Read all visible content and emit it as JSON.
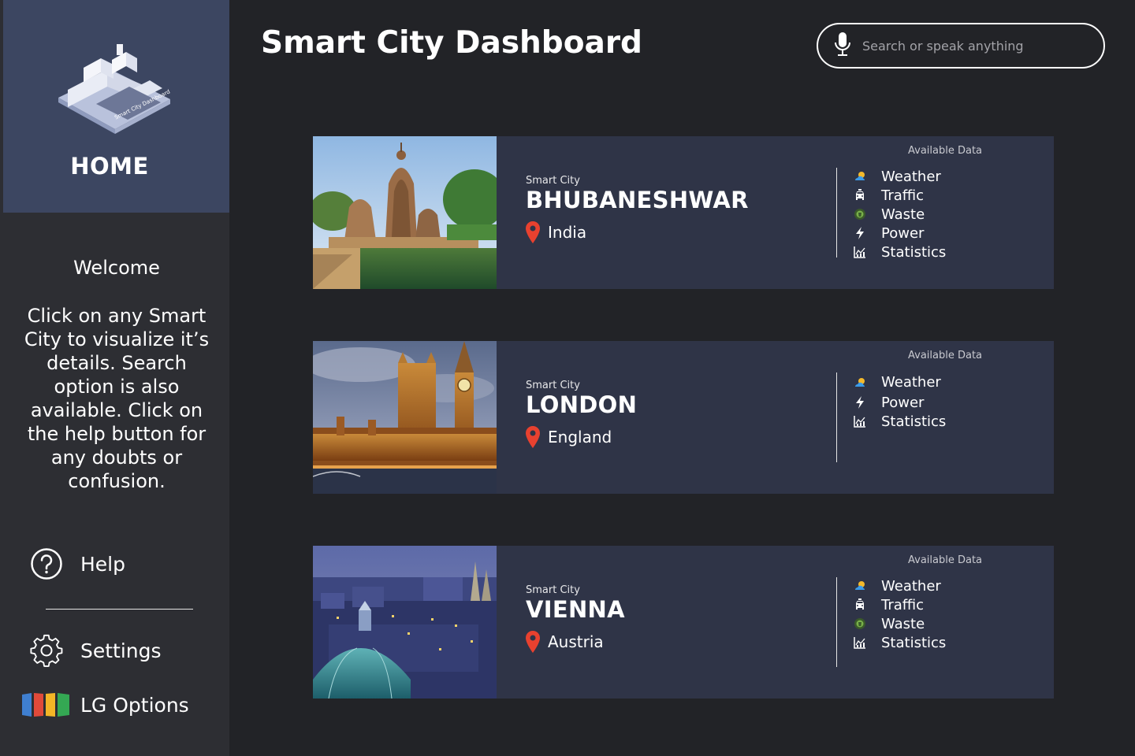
{
  "sidebar": {
    "home_label": "HOME",
    "welcome_title": "Welcome",
    "welcome_text": "Click on any Smart City to visualize it’s details. Search option is also available. Click on the help button for any doubts or confusion.",
    "help_label": "Help",
    "settings_label": "Settings",
    "lg_label": "LG Options"
  },
  "header": {
    "title": "Smart City Dashboard",
    "search_placeholder": "Search or speak anything"
  },
  "colors": {
    "background": "#222327",
    "sidebar": "#2d2e33",
    "home_panel": "#3c4661",
    "card": "#2f3447",
    "pin": "#e8412f"
  },
  "available_label": "Available Data",
  "city_kicker": "Smart City",
  "cities": [
    {
      "name": "BHUBANESHWAR",
      "country": "India",
      "data": [
        {
          "icon": "weather-icon",
          "label": "Weather"
        },
        {
          "icon": "traffic-icon",
          "label": "Traffic"
        },
        {
          "icon": "waste-icon",
          "label": "Waste"
        },
        {
          "icon": "power-icon",
          "label": "Power"
        },
        {
          "icon": "statistics-icon",
          "label": "Statistics"
        }
      ]
    },
    {
      "name": "LONDON",
      "country": "England",
      "data": [
        {
          "icon": "weather-icon",
          "label": "Weather"
        },
        {
          "icon": "power-icon",
          "label": "Power"
        },
        {
          "icon": "statistics-icon",
          "label": "Statistics"
        }
      ]
    },
    {
      "name": "VIENNA",
      "country": "Austria",
      "data": [
        {
          "icon": "weather-icon",
          "label": "Weather"
        },
        {
          "icon": "traffic-icon",
          "label": "Traffic"
        },
        {
          "icon": "waste-icon",
          "label": "Waste"
        },
        {
          "icon": "statistics-icon",
          "label": "Statistics"
        }
      ]
    }
  ]
}
